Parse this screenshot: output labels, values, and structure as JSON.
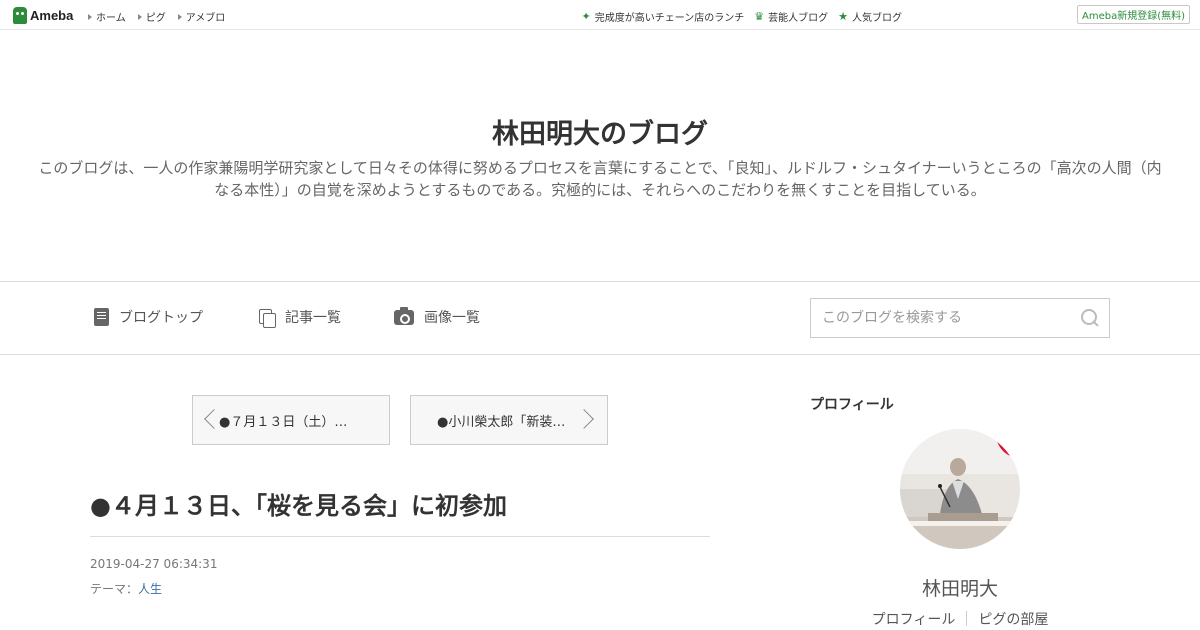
{
  "topbar": {
    "logo_text": "Ameba",
    "nav": [
      "ホーム",
      "ピグ",
      "アメブロ"
    ],
    "links": [
      {
        "label": "完成度が高いチェーン店のランチ",
        "icon": "sparkle-icon"
      },
      {
        "label": "芸能人ブログ",
        "icon": "crown-icon"
      },
      {
        "label": "人気ブログ",
        "icon": "star-icon"
      }
    ],
    "signup_label": "Ameba新規登録(無料)",
    "accent": "#2d8c3c"
  },
  "header": {
    "title": "林田明大のブログ",
    "description": "このブログは、一人の作家兼陽明学研究家として日々その体得に努めるプロセスを言葉にすることで、「良知」、ルドルフ・シュタイナーいうところの「高次の人間（内なる本性）」の自覚を深めようとするものである。究極的には、それらへのこだわりを無くすことを目指している。"
  },
  "nav": {
    "items": [
      {
        "label": "ブログトップ",
        "icon": "document-icon"
      },
      {
        "label": "記事一覧",
        "icon": "copy-icon"
      },
      {
        "label": "画像一覧",
        "icon": "camera-icon"
      }
    ],
    "search_placeholder": "このブログを検索する"
  },
  "pager": {
    "prev_label": "●７月１３日（土）…",
    "next_label": "●小川榮太郎「新装…"
  },
  "article": {
    "title": "●４月１３日、「桜を見る会」に初参加",
    "date": "2019-04-27 06:34:31",
    "theme_prefix": "テーマ：",
    "theme": "人生"
  },
  "sidebar": {
    "heading": "プロフィール",
    "name": "林田明大",
    "links": [
      "プロフィール",
      "ピグの部屋"
    ]
  }
}
